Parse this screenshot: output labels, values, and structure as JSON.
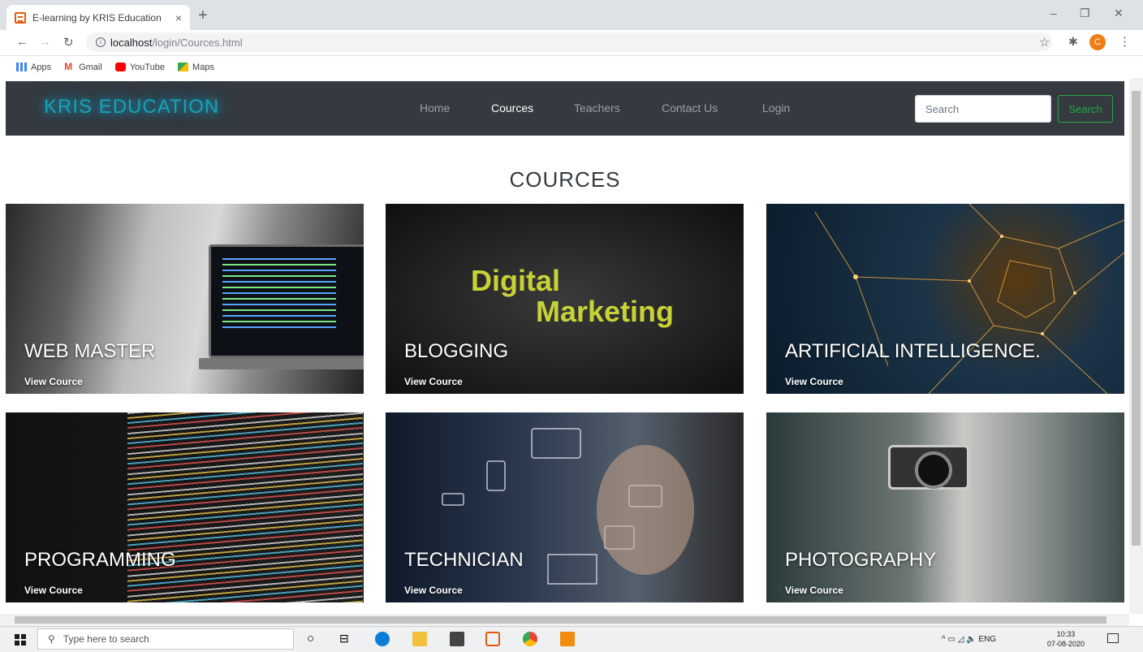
{
  "browser": {
    "tab_title": "E-learning by KRIS Education",
    "tab_close": "×",
    "new_tab": "+",
    "url_host": "localhost",
    "url_path": "/login/Cources.html",
    "window_controls": {
      "minimize": "–",
      "restore": "❐",
      "close": "✕"
    },
    "profile_initial": "C",
    "bookmarks": [
      {
        "label": "Apps",
        "icon": "apps-grid-icon",
        "color": "#4285f4"
      },
      {
        "label": "Gmail",
        "icon": "gmail-icon",
        "color": "#ea4335"
      },
      {
        "label": "YouTube",
        "icon": "youtube-icon",
        "color": "#ff0000"
      },
      {
        "label": "Maps",
        "icon": "maps-icon",
        "color": "#34a853"
      }
    ]
  },
  "navbar": {
    "brand": "KRIS EDUCATION",
    "links": [
      {
        "label": "Home",
        "active": false
      },
      {
        "label": "Cources",
        "active": true
      },
      {
        "label": "Teachers",
        "active": false
      },
      {
        "label": "Contact Us",
        "active": false
      },
      {
        "label": "Login",
        "active": false
      }
    ],
    "search_placeholder": "Search",
    "search_button": "Search",
    "accent_color": "#17a2b8",
    "bg_color": "#343a40"
  },
  "main": {
    "title": "COURCES",
    "view_label": "View Cource",
    "cards": [
      {
        "title": "WEB MASTER",
        "image": "laptop-code-photo"
      },
      {
        "title": "BLOGGING",
        "image": "digital-marketing-photo",
        "image_text": [
          "Digital",
          "Marketing"
        ]
      },
      {
        "title": "ARTIFICIAL INTELLIGENCE.",
        "image": "neural-network-photo"
      },
      {
        "title": "PROGRAMMING",
        "image": "code-screen-photo"
      },
      {
        "title": "TECHNICIAN",
        "image": "touch-tech-photo"
      },
      {
        "title": "PHOTOGRAPHY",
        "image": "camera-hand-photo"
      }
    ]
  },
  "taskbar": {
    "search_placeholder": "Type here to search",
    "tray_text": "^ ▭ ◿ 🔈 ENG",
    "time": "10:33",
    "date": "07-08-2020"
  }
}
